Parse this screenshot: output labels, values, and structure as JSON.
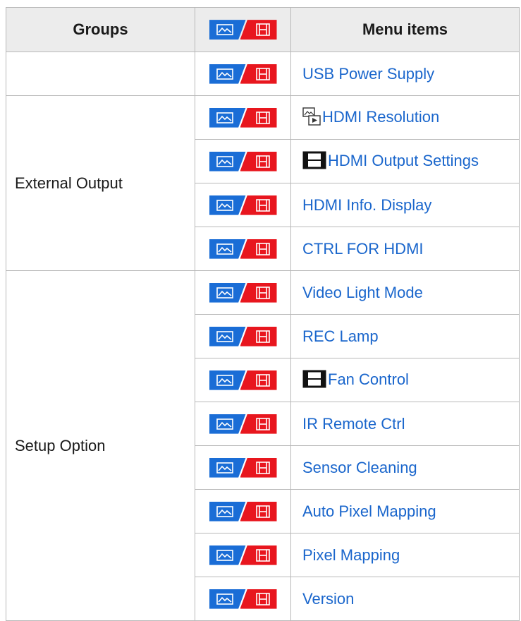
{
  "header": {
    "groups": "Groups",
    "menu_items": "Menu items"
  },
  "mode_icon": {
    "still_icon": "still-image-icon",
    "movie_icon": "movie-icon",
    "still_color": "#1a6dd6",
    "movie_color": "#e8161e"
  },
  "rows": [
    {
      "group": "",
      "item": "USB Power Supply",
      "item_icon": null
    },
    {
      "group": "External Output",
      "item": "HDMI Resolution",
      "item_icon": "still-playback-icon"
    },
    {
      "group": "External Output",
      "item": "HDMI Output Settings",
      "item_icon": "movie-icon"
    },
    {
      "group": "External Output",
      "item": "HDMI Info. Display",
      "item_icon": null
    },
    {
      "group": "External Output",
      "item": "CTRL FOR HDMI",
      "item_icon": null
    },
    {
      "group": "Setup Option",
      "item": "Video Light Mode",
      "item_icon": null
    },
    {
      "group": "Setup Option",
      "item": "REC Lamp",
      "item_icon": null
    },
    {
      "group": "Setup Option",
      "item": "Fan Control",
      "item_icon": "movie-icon"
    },
    {
      "group": "Setup Option",
      "item": "IR Remote Ctrl",
      "item_icon": null
    },
    {
      "group": "Setup Option",
      "item": "Sensor Cleaning",
      "item_icon": null
    },
    {
      "group": "Setup Option",
      "item": "Auto Pixel Mapping",
      "item_icon": null
    },
    {
      "group": "Setup Option",
      "item": "Pixel Mapping",
      "item_icon": null
    },
    {
      "group": "Setup Option",
      "item": "Version",
      "item_icon": null
    }
  ]
}
